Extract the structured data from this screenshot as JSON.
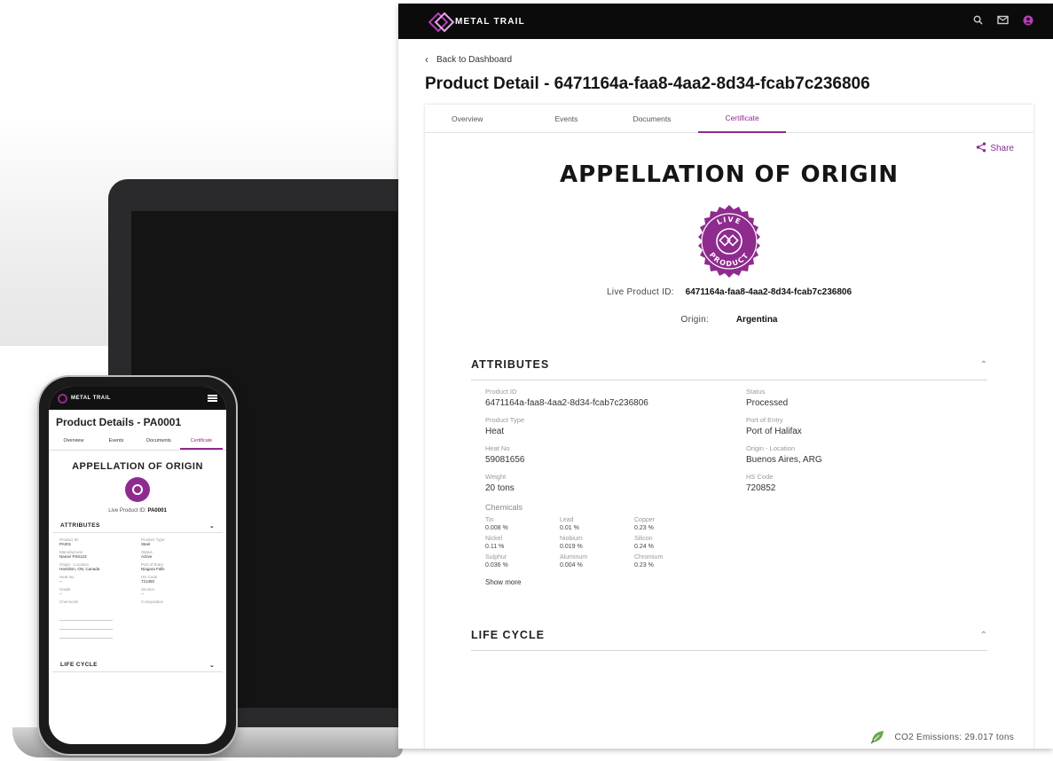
{
  "colors": {
    "accent": "#8e2b8e",
    "topbar": "#0b0b0b"
  },
  "app": {
    "brand": "METAL TRAIL",
    "icons": [
      "search-icon",
      "mail-icon",
      "user-icon"
    ],
    "back_label": "Back to Dashboard",
    "page_title": "Product Detail - 6471164a-faa8-4aa2-8d34-fcab7c236806",
    "tabs": [
      {
        "label": "Overview"
      },
      {
        "label": "Events"
      },
      {
        "label": "Documents"
      },
      {
        "label": "Certificate",
        "active": true
      }
    ],
    "share_label": "Share",
    "cert_heading": "APPELLATION OF ORIGIN",
    "badge_top": "LIVE",
    "badge_bottom": "PRODUCT",
    "live_id_label": "Live Product ID:",
    "live_id_value": "6471164a-faa8-4aa2-8d34-fcab7c236806",
    "origin_label": "Origin:",
    "origin_value": "Argentina",
    "attributes": {
      "title": "ATTRIBUTES",
      "left": [
        {
          "label": "Product ID",
          "value": "6471164a-faa8-4aa2-8d34-fcab7c236806"
        },
        {
          "label": "Product Type",
          "value": "Heat"
        },
        {
          "label": "Heat No",
          "value": "59081656"
        },
        {
          "label": "Weight",
          "value": "20 tons"
        }
      ],
      "right": [
        {
          "label": "Status",
          "value": "Processed"
        },
        {
          "label": "Port of Entry",
          "value": "Port of Halifax"
        },
        {
          "label": "Origin - Location",
          "value": "Buenos Aires, ARG"
        },
        {
          "label": "HS Code",
          "value": "720852"
        }
      ],
      "chemicals_title": "Chemicals",
      "chemicals": [
        {
          "label": "Tin",
          "value": "0.008 %"
        },
        {
          "label": "Lead",
          "value": "0.01 %"
        },
        {
          "label": "Copper",
          "value": "0.23 %"
        },
        {
          "label": "Nickel",
          "value": "0.11 %"
        },
        {
          "label": "Niobium",
          "value": "0.019 %"
        },
        {
          "label": "Silicon",
          "value": "0.24 %"
        },
        {
          "label": "Sulphur",
          "value": "0.036 %"
        },
        {
          "label": "Aluminum",
          "value": "0.004 %"
        },
        {
          "label": "Chromium",
          "value": "0.23 %"
        }
      ],
      "show_more": "Show more"
    },
    "lifecycle_title": "LIFE CYCLE",
    "co2": "CO2 Emissions: 29.017 tons"
  },
  "phone": {
    "brand": "METAL TRAIL",
    "title": "Product Details - PA0001",
    "tabs": [
      "Overview",
      "Events",
      "Documents",
      "Certificate"
    ],
    "cert_heading": "APPELLATION OF ORIGIN",
    "live_id_label": "Live Product ID:",
    "live_id_value": "PA0001",
    "attributes_title": "ATTRIBUTES",
    "fields": [
      {
        "label": "Product ID",
        "value": "PA001"
      },
      {
        "label": "Product Type",
        "value": "Steel"
      },
      {
        "label": "Manufacturer",
        "value": "Name/ PS0123"
      },
      {
        "label": "Status",
        "value": "Active"
      },
      {
        "label": "Origin - Location",
        "value": "Hamilton, ON, Canada"
      },
      {
        "label": "Port of Entry",
        "value": "Niagara Falls"
      },
      {
        "label": "Heat No",
        "value": "--"
      },
      {
        "label": "HS Code",
        "value": "721350"
      },
      {
        "label": "Grade",
        "value": "--"
      },
      {
        "label": "Section",
        "value": "--"
      }
    ],
    "chemicals_label": "Chemicals",
    "composition_label": "Composition",
    "lifecycle_title": "LIFE CYCLE"
  }
}
